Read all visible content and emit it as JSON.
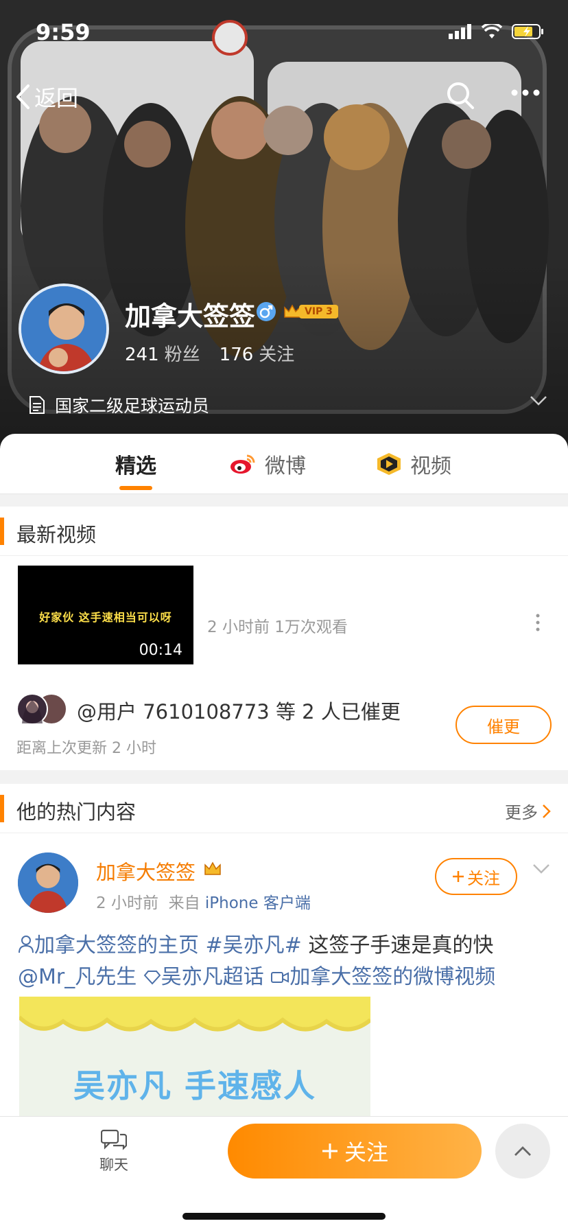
{
  "status_bar": {
    "time": "9:59"
  },
  "nav": {
    "back_label": "返回"
  },
  "profile": {
    "name": "加拿大签签",
    "vip_label": "VIP 3",
    "followers_count": "241",
    "followers_label": "粉丝",
    "following_count": "176",
    "following_label": "关注",
    "bio": "国家二级足球运动员"
  },
  "tabs": [
    {
      "label": "精选"
    },
    {
      "label": "微博"
    },
    {
      "label": "视频"
    }
  ],
  "latest_videos": {
    "title": "最新视频",
    "video": {
      "caption": "好家伙 这手速相当可以呀",
      "duration": "00:14",
      "meta": "2 小时前 1万次观看"
    },
    "urge_text": "@用户 7610108773 等 2 人已催更",
    "last_update": "距离上次更新 2 小时",
    "urge_button": "催更"
  },
  "hot_content": {
    "title": "他的热门内容",
    "more_label": "更多",
    "post": {
      "author": "加拿大签签",
      "time": "2 小时前",
      "from_prefix": "来自",
      "source": "iPhone 客户端",
      "follow_label": "关注",
      "line1_link1": "加拿大签签的主页",
      "line1_tag": "#吴亦凡#",
      "line1_text": "这签子手速是真的快",
      "line2_mention": "@Mr_凡先生",
      "line2_super": "吴亦凡超话",
      "line2_video": "加拿大签签的微博视频",
      "image_text": "吴亦凡 手速感人"
    }
  },
  "bottom_bar": {
    "chat_label": "聊天",
    "follow_label": "关注"
  },
  "colors": {
    "accent": "#ff8200",
    "link": "#4a6fa8"
  }
}
